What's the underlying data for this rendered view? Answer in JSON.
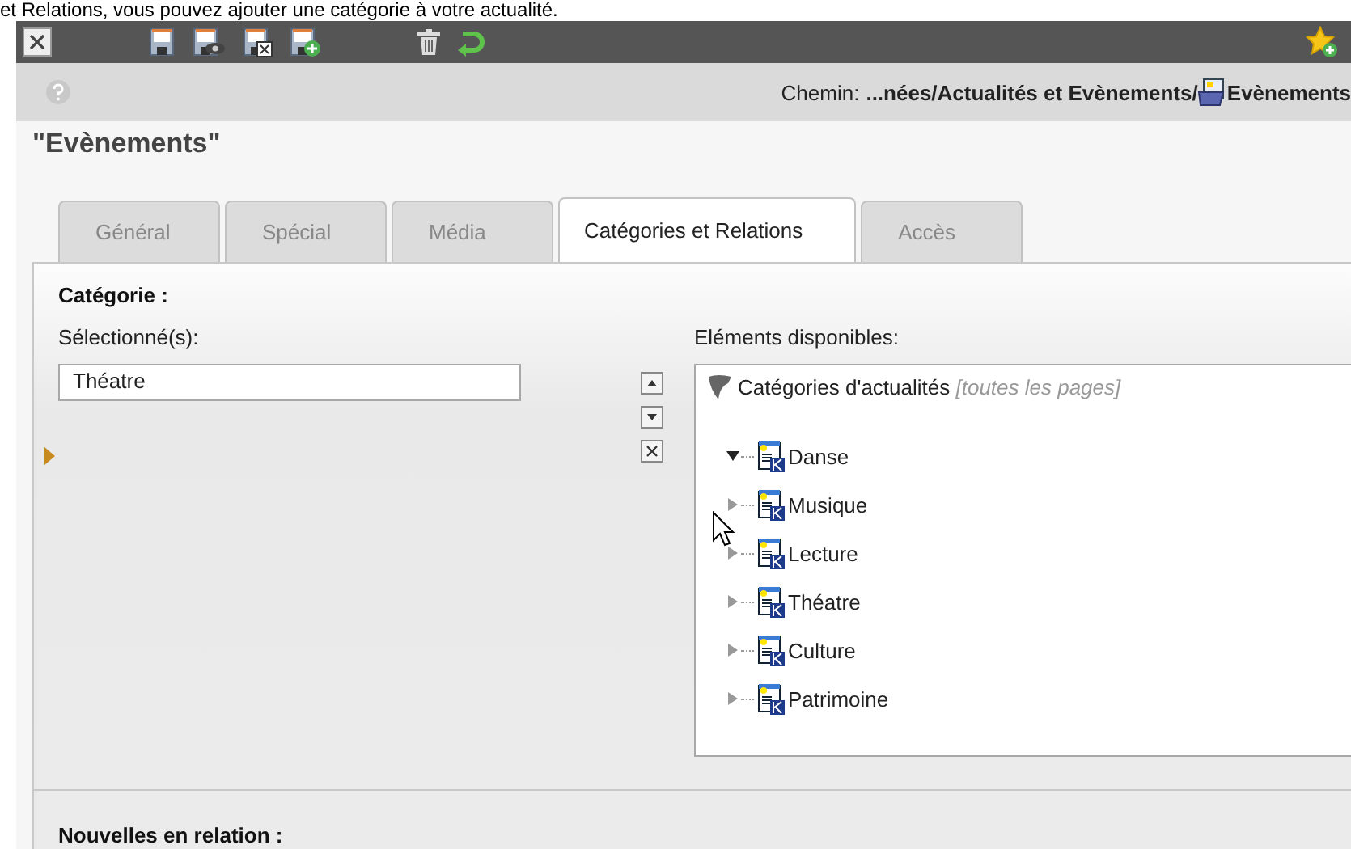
{
  "intro_text": "et Relations, vous pouvez ajouter une catégorie à votre actualité.",
  "toolbar": {
    "buttons": [
      {
        "kind": "close"
      },
      {
        "kind": "save"
      },
      {
        "kind": "save-view"
      },
      {
        "kind": "save-close"
      },
      {
        "kind": "save-new"
      },
      {
        "kind": "delete"
      },
      {
        "kind": "undo"
      },
      {
        "kind": "bookmark"
      }
    ]
  },
  "path_bar": {
    "label": "Chemin:",
    "path": "...nées/Actualités et Evènements/",
    "page": "Evènements"
  },
  "heading": "\"Evènements\"",
  "tabs": [
    {
      "label": "Général",
      "selected": false
    },
    {
      "label": "Spécial",
      "selected": false
    },
    {
      "label": "Média",
      "selected": false
    },
    {
      "label": "Catégories et Relations",
      "selected": true
    },
    {
      "label": "Accès",
      "selected": false
    }
  ],
  "category": {
    "title": "Catégorie :",
    "selected_label": "Sélectionné(s):",
    "selected_items": [
      "Théatre"
    ],
    "available_label": "Eléments disponibles:",
    "tree": {
      "root": "Catégories d'actualités",
      "root_note": "[toutes les pages]",
      "children": [
        {
          "label": "Danse",
          "expanded": true
        },
        {
          "label": "Musique",
          "expanded": false
        },
        {
          "label": "Lecture",
          "expanded": false
        },
        {
          "label": "Théatre",
          "expanded": false
        },
        {
          "label": "Culture",
          "expanded": false
        },
        {
          "label": "Patrimoine",
          "expanded": false
        }
      ]
    }
  },
  "related_title": "Nouvelles en relation :"
}
